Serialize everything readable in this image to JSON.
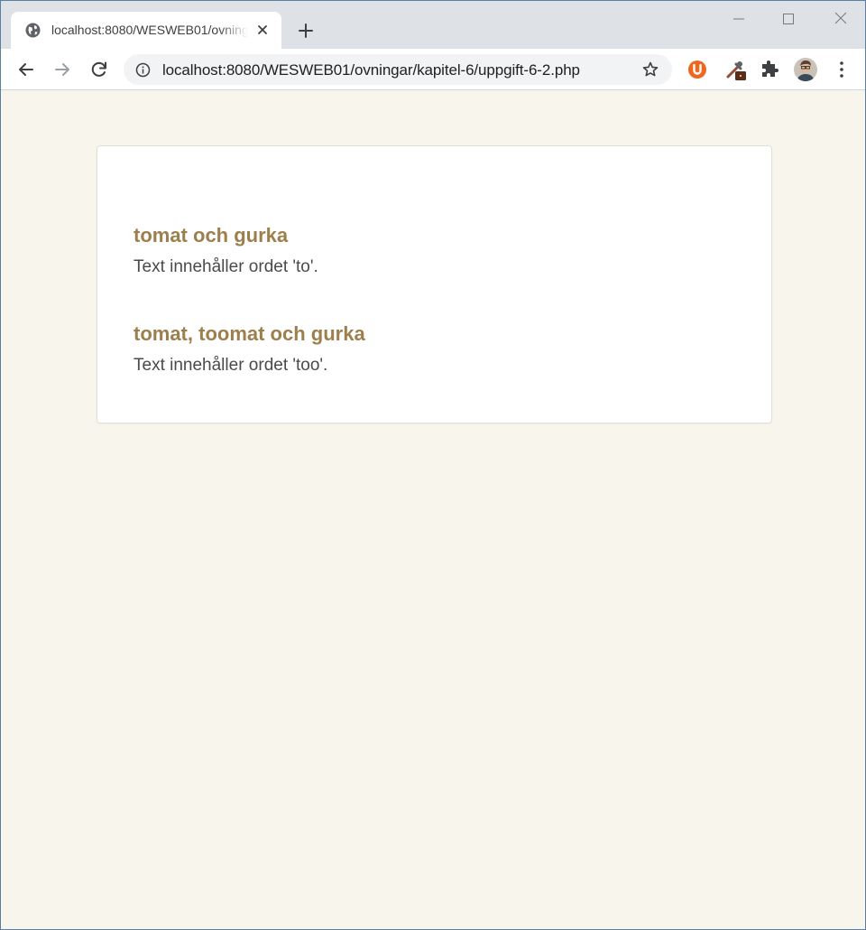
{
  "browser": {
    "tab": {
      "title": "localhost:8080/WESWEB01/ovningar/kapitel-6/uppgift-6-2.php"
    },
    "address_bar": {
      "url": "localhost:8080/WESWEB01/ovningar/kapitel-6/uppgift-6-2.php"
    },
    "extensions": [
      "ublock-origin-icon",
      "eyedropper-icon",
      "extensions-puzzle-icon"
    ],
    "accent_colors": {
      "tabstrip": "#dee1e6",
      "omnibox": "#f1f3f4",
      "ext_u": "#f0661e"
    }
  },
  "page": {
    "background": "#f8f6ec",
    "heading_color": "#9c7f4c",
    "entries": [
      {
        "heading": "tomat och gurka",
        "text": "Text innehåller ordet 'to'."
      },
      {
        "heading": "tomat, toomat och gurka",
        "text": "Text innehåller ordet 'too'."
      }
    ]
  }
}
